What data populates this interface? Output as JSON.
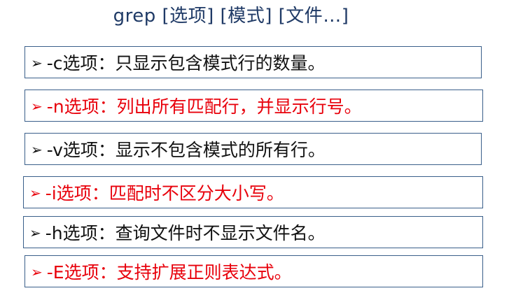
{
  "title": "grep [选项] [模式] [文件…]",
  "colors": {
    "title": "#1f3a66",
    "normal_text": "#111111",
    "highlight_text": "#e8000b",
    "box_border": "#3a5f8a"
  },
  "bullet_icon": "arrow-bullet-icon",
  "options": [
    {
      "text": "-c选项：只显示包含模式行的数量。",
      "highlight": false
    },
    {
      "text": "-n选项：列出所有匹配行，并显示行号。",
      "highlight": true
    },
    {
      "text": "-v选项：显示不包含模式的所有行。",
      "highlight": false
    },
    {
      "text": "-i选项：匹配时不区分大小写。",
      "highlight": true
    },
    {
      "text": "-h选项：查询文件时不显示文件名。",
      "highlight": false
    },
    {
      "text": "-E选项：支持扩展正则表达式。",
      "highlight": true
    }
  ]
}
